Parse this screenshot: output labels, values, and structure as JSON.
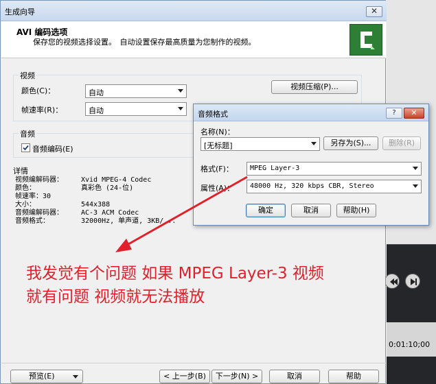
{
  "wizard": {
    "title": "生成向导",
    "close_glyph": "✕",
    "header_title": "AVI 编码选项",
    "header_subtitle": "保存您的视频选择设置。　自动设置保存最高质量为您制作的视频。"
  },
  "video_group": {
    "label": "视频",
    "color_label": "颜色(C)：",
    "color_value": "自动",
    "framerate_label": "帧速率(R)：",
    "framerate_value": "自动",
    "compress_button": "视频压缩(P)..."
  },
  "audio_group": {
    "label": "音频",
    "checkbox_label": "音频编码(E)",
    "checkbox_checked": true
  },
  "details": {
    "label": "详情",
    "lines": [
      {
        "key": "视频编解码器：",
        "value": "Xvid MPEG-4 Codec"
      },
      {
        "key": "颜色：",
        "value": "真彩色 (24-位)"
      },
      {
        "key": "帧速率：30",
        "value": ""
      },
      {
        "key": "大小：",
        "value": "544x388"
      },
      {
        "key": "音频编解码器：",
        "value": "AC-3 ACM Codec"
      },
      {
        "key": "音频格式：",
        "value": "32000Hz, 单声道, 3KB/..."
      }
    ]
  },
  "audio_dialog": {
    "title": "音频格式",
    "help_glyph": "?",
    "close_glyph": "✕",
    "name_label": "名称(N)：",
    "name_value": "[无标题]",
    "save_as_button": "另存为(S)...",
    "delete_button": "删除(R)",
    "format_label": "格式(F)：",
    "format_value": "MPEG Layer-3",
    "attributes_label": "属性(A)：",
    "attributes_value": "48000 Hz, 320 kbps CBR, Stereo",
    "ok_button": "确定",
    "cancel_button": "取消",
    "help_button": "帮助(H)"
  },
  "footer": {
    "preview_button": "预览(E)",
    "back_button": "< 上一步(B)",
    "next_button": "下一步(N) >",
    "cancel_button": "取消",
    "help_button": "帮助"
  },
  "background_app": {
    "timecode": "0:01:10;00"
  },
  "annotation": {
    "line1": "我发觉有个问题 如果 MPEG Layer-3 视频",
    "line2": "就有问题 视频就无法播放",
    "color": "#e0202a"
  },
  "colors": {
    "logo_green": "#2c7f34",
    "annotation_red": "#e0202a"
  }
}
